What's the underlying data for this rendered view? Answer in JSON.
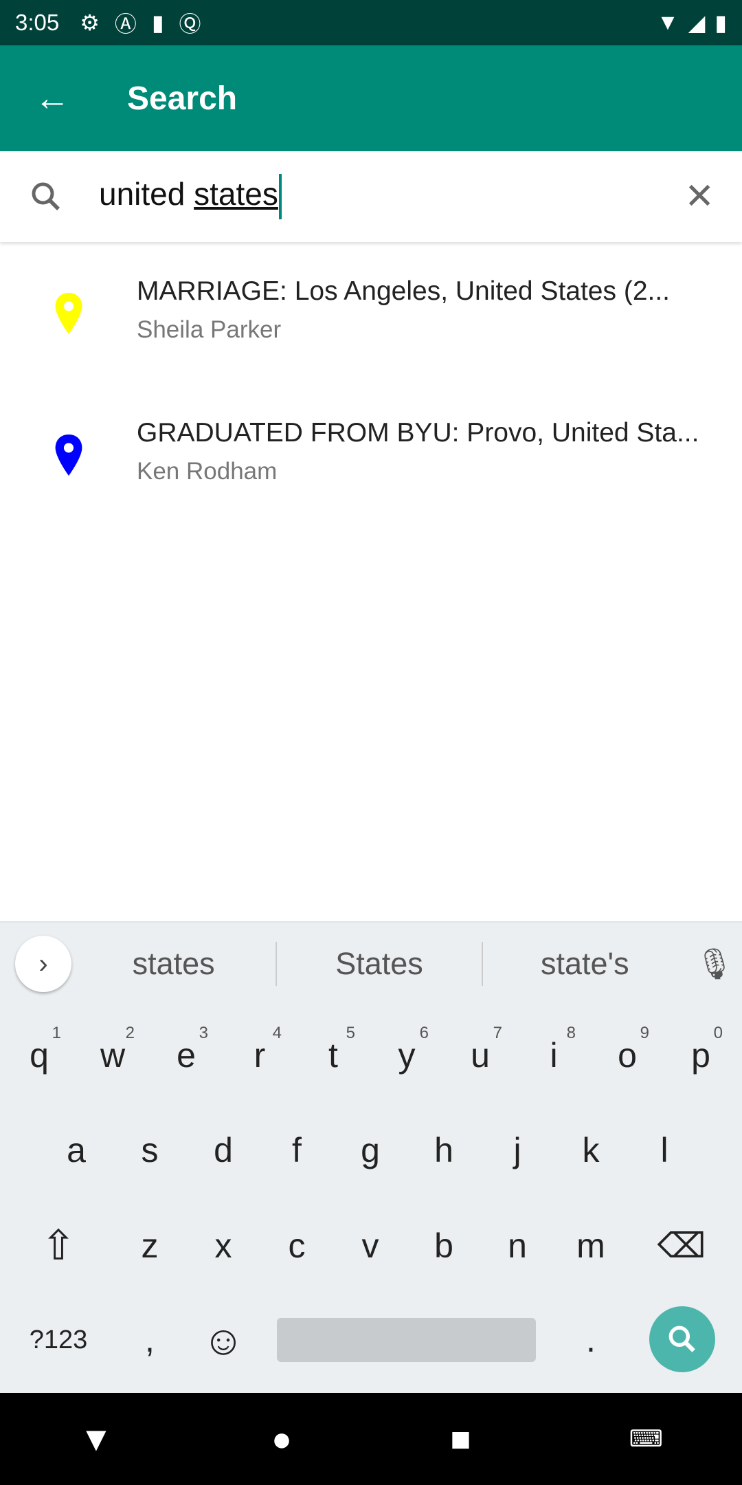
{
  "status_bar": {
    "time": "3:05",
    "icons": [
      "gear-icon",
      "a-icon",
      "sd-card-icon",
      "q-icon"
    ],
    "right_icons": [
      "wifi-icon",
      "signal-icon",
      "battery-icon"
    ]
  },
  "app_bar": {
    "title": "Search",
    "back_icon": "arrow-back-icon",
    "background": "#008a78"
  },
  "search": {
    "query_plain": "united ",
    "query_underlined": "states",
    "clear_icon": "close-icon"
  },
  "results": [
    {
      "title": "MARRIAGE: Los Angeles, United States (2...",
      "subtitle": "Sheila Parker",
      "pin_color": "#ffff00"
    },
    {
      "title": "GRADUATED FROM BYU: Provo, United Sta...",
      "subtitle": "Ken Rodham",
      "pin_color": "#0000ff"
    }
  ],
  "keyboard": {
    "suggestions": [
      "states",
      "States",
      "state's"
    ],
    "row1": [
      [
        "q",
        "1"
      ],
      [
        "w",
        "2"
      ],
      [
        "e",
        "3"
      ],
      [
        "r",
        "4"
      ],
      [
        "t",
        "5"
      ],
      [
        "y",
        "6"
      ],
      [
        "u",
        "7"
      ],
      [
        "i",
        "8"
      ],
      [
        "o",
        "9"
      ],
      [
        "p",
        "0"
      ]
    ],
    "row2": [
      "a",
      "s",
      "d",
      "f",
      "g",
      "h",
      "j",
      "k",
      "l"
    ],
    "row3": [
      "z",
      "x",
      "c",
      "v",
      "b",
      "n",
      "m"
    ],
    "symbols": "?123",
    "comma": ",",
    "period": "."
  }
}
